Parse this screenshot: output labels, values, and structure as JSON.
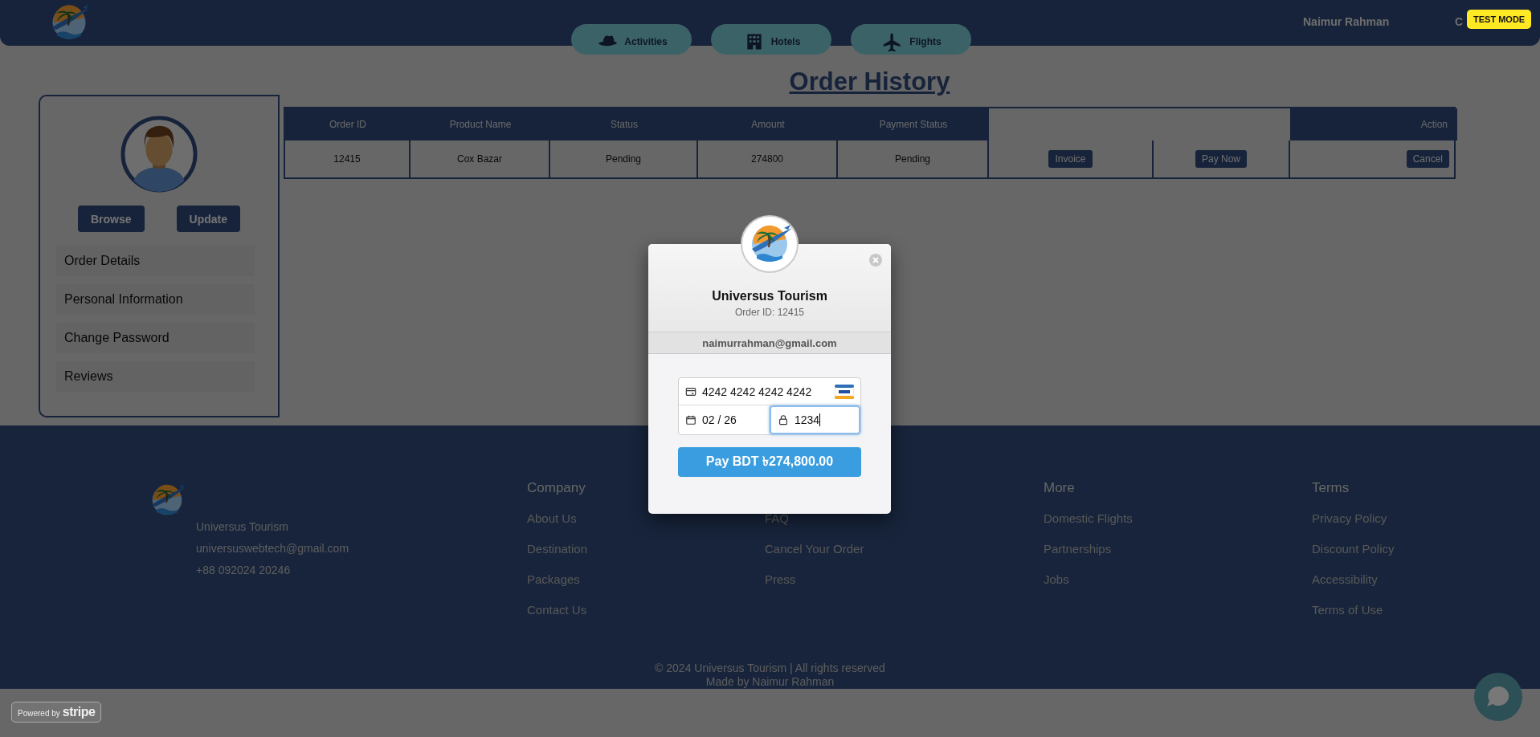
{
  "header": {
    "user": "Naimur Rahman",
    "cut_item": "C",
    "badge": "TEST MODE"
  },
  "nav": [
    {
      "label": "Activities"
    },
    {
      "label": "Hotels"
    },
    {
      "label": "Flights"
    }
  ],
  "page_title": "Order History",
  "profile": {
    "buttons": [
      "Browse",
      "Update"
    ],
    "menu": [
      "Order Details",
      "Personal Information",
      "Change Password",
      "Reviews"
    ]
  },
  "orders": {
    "columns": [
      "Order ID",
      "Product Name",
      "Status",
      "Amount",
      "Payment Status",
      "Action"
    ],
    "rows": [
      {
        "cells": [
          "12415",
          "Cox Bazar",
          "Pending",
          "274800",
          "Pending"
        ],
        "actions": [
          "Invoice",
          "Pay Now",
          "Cancel"
        ]
      }
    ]
  },
  "footer": {
    "brand": "Universus Tourism",
    "email": "universuswebtech@gmail.com",
    "phone": "+88 092024 20246",
    "columns": [
      {
        "title": "Company",
        "links": [
          "About Us",
          "Destination",
          "Packages",
          "Contact Us"
        ]
      },
      {
        "links": [
          "FAQ",
          "Cancel Your Order",
          "Press"
        ]
      },
      {
        "title": "More",
        "links": [
          "Domestic Flights",
          "Partnerships",
          "Jobs"
        ]
      },
      {
        "title": "Terms",
        "links": [
          "Privacy Policy",
          "Discount Policy",
          "Accessibility",
          "Terms of Use"
        ]
      }
    ],
    "copyright": "© 2024 Universus Tourism | All rights reserved",
    "credit": "Made by Naimur Rahman"
  },
  "checkout": {
    "title": "Universus Tourism",
    "subtitle": "Order ID: 12415",
    "email": "naimurrahman@gmail.com",
    "fields": [
      {
        "kind": "card",
        "value": "4242 4242 4242 4242",
        "focused": false
      },
      {
        "kind": "expiry",
        "value": "02 / 26",
        "focused": false
      },
      {
        "kind": "cvc",
        "value": "1234",
        "focused": true
      }
    ],
    "pay_button": "Pay BDT ৳274,800.00"
  },
  "stripe_badge": {
    "prefix": "Powered by",
    "brand": "stripe"
  }
}
